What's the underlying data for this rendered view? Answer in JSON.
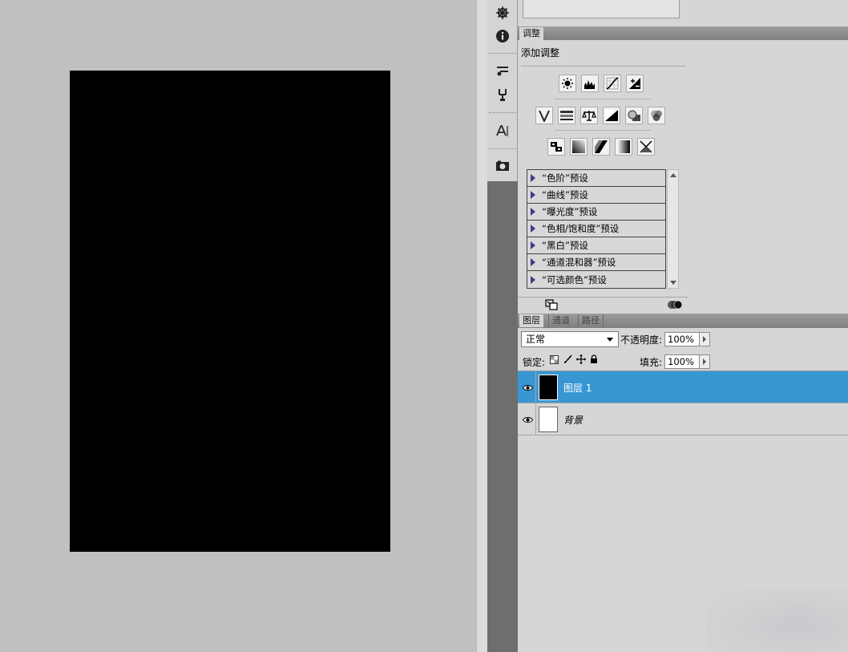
{
  "adjustments": {
    "tab_label": "调整",
    "title": "添加调整",
    "icons_row1": [
      "brightness-contrast-icon",
      "levels-icon",
      "curves-icon",
      "exposure-icon"
    ],
    "icons_row2": [
      "vibrance-icon",
      "hue-saturation-icon",
      "color-balance-icon",
      "black-white-icon",
      "photo-filter-icon",
      "channel-mixer-icon"
    ],
    "icons_row3": [
      "invert-icon",
      "posterize-icon",
      "threshold-icon",
      "gradient-map-icon",
      "selective-color-icon"
    ],
    "presets": [
      "“色阶”预设",
      "“曲线”预设",
      "“曝光度”预设",
      "“色相/饱和度”预设",
      "“黑白”预设",
      "“通道混和器”预设",
      "“可选颜色”预设"
    ]
  },
  "layers_panel": {
    "tabs": [
      "图层",
      "通道",
      "路径"
    ],
    "blend_mode": "正常",
    "opacity_label": "不透明度:",
    "opacity_value": "100%",
    "lock_label": "锁定:",
    "fill_label": "填充:",
    "fill_value": "100%",
    "layers": [
      {
        "name": "图层 1",
        "selected": true,
        "thumb": "#000000"
      },
      {
        "name": "背景",
        "selected": false,
        "thumb": "#ffffff"
      }
    ]
  },
  "colors": {
    "selection": "#3897d3",
    "canvas_fill": "#000000",
    "workspace": "#c0c0c0"
  }
}
